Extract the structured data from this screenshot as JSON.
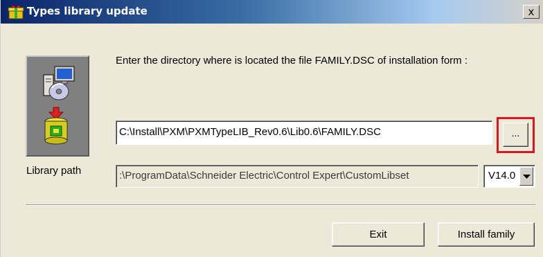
{
  "window": {
    "title": "Types library update",
    "close_glyph": "x",
    "title_icon": "gift-box-icon"
  },
  "icon_panel": {
    "icons": [
      "computer-disc-icon",
      "install-drum-icon"
    ]
  },
  "instruction_text": "Enter the directory where is located the file FAMILY.DSC of installation form :",
  "file_path": {
    "value": "C:\\Install\\PXM\\PXMTypeLIB_Rev0.6\\Lib0.6\\FAMILY.DSC"
  },
  "browse_button": {
    "label": "...",
    "highlight_color": "#e1141e"
  },
  "library_path": {
    "label": "Library path",
    "value": ":\\ProgramData\\Schneider Electric\\Control Expert\\CustomLibset"
  },
  "version_select": {
    "selected": "V14.0"
  },
  "buttons": {
    "exit": "Exit",
    "install": "Install family"
  }
}
